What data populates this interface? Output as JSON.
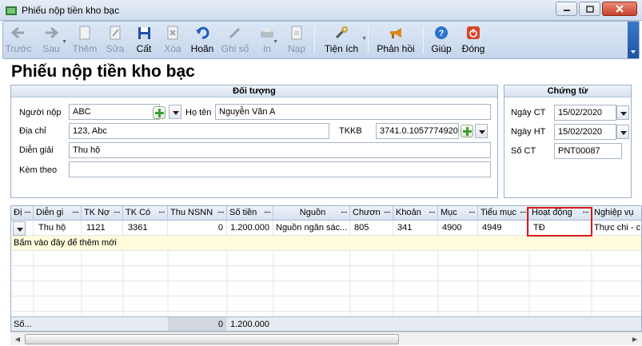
{
  "window": {
    "title": "Phiếu nộp tiền kho bạc"
  },
  "toolbar": {
    "back": "Trước",
    "forward": "Sau",
    "add": "Thêm",
    "edit": "Sửa",
    "save": "Cất",
    "delete": "Xóa",
    "undo": "Hoãn",
    "post": "Ghi sổ",
    "print": "In",
    "load": "Nạp",
    "utilities": "Tiện ích",
    "feedback": "Phản hồi",
    "help": "Giúp",
    "close": "Đóng"
  },
  "page": {
    "heading": "Phiếu nộp tiền kho bạc"
  },
  "doi_tuong": {
    "title": "Đối tượng",
    "payer_label": "Người nộp",
    "payer_value": "ABC",
    "fullname_label": "Họ tên",
    "fullname_value": "Nguyễn Văn A",
    "address_label": "Địa chỉ",
    "address_value": "123, Abc",
    "tkkb_label": "TKKB",
    "tkkb_value": "3741.0.1057774920",
    "description_label": "Diễn giải",
    "description_value": "Thu hộ",
    "attach_label": "Kèm theo",
    "attach_value": ""
  },
  "chung_tu": {
    "title": "Chứng từ",
    "date_ct_label": "Ngày CT",
    "date_ct_value": "15/02/2020",
    "date_ht_label": "Ngày HT",
    "date_ht_value": "15/02/2020",
    "so_ct_label": "Số CT",
    "so_ct_value": "PNT00087"
  },
  "grid": {
    "headers": [
      "Đị",
      "Diễn gi",
      "TK Nợ",
      "TK Có",
      "Thu NSNN",
      "Số tiền",
      "Nguồn",
      "Chươn",
      "Khoản",
      "Mục",
      "Tiểu mục",
      "Hoạt động",
      "Nghiệp vụ"
    ],
    "row": [
      "Thu hộ",
      "1121",
      "3361",
      "0",
      "1.200.000",
      "Nguồn ngân sác...",
      "805",
      "341",
      "4900",
      "4949",
      "TĐ",
      "Thực chi - c"
    ],
    "new_row_hint": "Bấm vào đây để thêm mới",
    "footer_label": "Số...",
    "footer_nsnn": "0",
    "footer_total": "1.200.000"
  },
  "colors": {
    "accent": "#1d55a8",
    "highlight": "#d61a1a",
    "new_row_bg": "#fffbdc"
  }
}
